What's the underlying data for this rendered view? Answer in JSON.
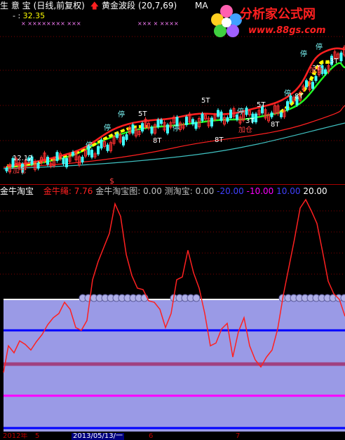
{
  "header": {
    "app": "生 意 宝",
    "mode": "(日线,前复权)",
    "indicator": "黄金波段",
    "params": "(20,7,69)",
    "ma_label": "MA",
    "price": "32.35"
  },
  "logo": {
    "title": "分析家公式网",
    "url": "www.88gs.com"
  },
  "main_chart": {
    "low_price_label": "12.12",
    "signals": [
      {
        "label": "5T"
      },
      {
        "label": "8T"
      },
      {
        "label": "5T"
      },
      {
        "label": "8T"
      },
      {
        "label": "5T"
      },
      {
        "label": "8T"
      },
      {
        "label": "3T"
      },
      {
        "label": "8T"
      },
      {
        "label": "3T"
      },
      {
        "label": "3T"
      }
    ],
    "stop_labels": [
      "停",
      "停",
      "停",
      "停",
      "停",
      "停",
      "停",
      "停"
    ],
    "add_labels": [
      "加仓",
      "加仓",
      "加仓"
    ]
  },
  "indicator_panel": {
    "name": "金牛淘宝",
    "items": [
      {
        "label": "金牛绳:",
        "value": "7.76",
        "color": "#ff2020"
      },
      {
        "label": "金牛淘宝图:",
        "value": "0.00",
        "color": "#c0c0c0"
      },
      {
        "label": "测淘宝:",
        "value": "0.00",
        "color": "#c0c0c0"
      },
      {
        "label": "",
        "value": "-20.00",
        "color": "#4040ff"
      },
      {
        "label": "",
        "value": "-10.00",
        "color": "#ff00ff"
      },
      {
        "label": "",
        "value": "10.00",
        "color": "#4040ff"
      },
      {
        "label": "",
        "value": "20.00",
        "color": "#ffffff"
      }
    ]
  },
  "footer": {
    "year": "2012年",
    "m1": "5",
    "selected_date": "2013/05/13/一",
    "m2": "6",
    "m3": "7"
  },
  "marker": "$",
  "colors": {
    "line": "#ff2020",
    "fill": "#9a9ae6",
    "blue_line": "#0000ff",
    "purple_line": "#a04080",
    "magenta_line": "#ff00ff"
  }
}
